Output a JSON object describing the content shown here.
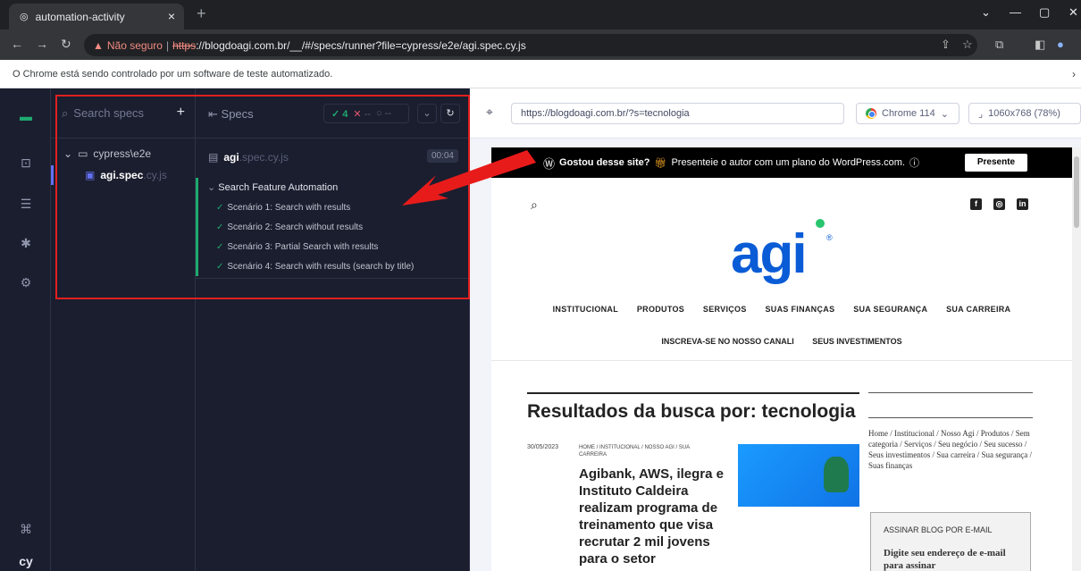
{
  "browser": {
    "tab_title": "automation-activity",
    "tab_close": "×",
    "new_tab": "+",
    "not_secure": "Não seguro",
    "url_scheme": "https",
    "url_rest": "://blogdoagi.com.br/__/#/specs/runner?file=cypress/e2e/agi.spec.cy.js",
    "automation_notice": "O Chrome está sendo controlado por um software de teste automatizado."
  },
  "specs_panel": {
    "search_placeholder": "Search specs",
    "folder": "cypress\\e2e",
    "file_name": "agi.spec",
    "file_ext": ".cy.js"
  },
  "reporter": {
    "title": "Specs",
    "passed": "4",
    "failed": "--",
    "pending": "--",
    "spec_name": "agi",
    "spec_ext": ".spec.cy.js",
    "duration": "00:04",
    "suite_title": "Search Feature Automation",
    "tests": [
      "Scenário 1: Search with results",
      "Scenário 2: Search without results",
      "Scenário 3: Partial Search with results",
      "Scenário 4: Search with results (search by title)"
    ]
  },
  "aut": {
    "url": "https://blogdoagi.com.br/?s=tecnologia",
    "browser": "Chrome 114",
    "viewport": "1060x768 (78%)"
  },
  "site": {
    "wp_bold": "Gostou desse site?",
    "wp_text": "Presenteie o autor com um plano do WordPress.com.",
    "wp_button": "Presente",
    "logo": "agi",
    "logo_reg": "®",
    "menu_row1": [
      "INSTITUCIONAL",
      "PRODUTOS",
      "SERVIÇOS",
      "SUAS FINANÇAS",
      "SUA SEGURANÇA",
      "SUA CARREIRA"
    ],
    "menu_row2": [
      "INSCREVA-SE NO NOSSO CANALI",
      "SEUS INVESTIMENTOS"
    ],
    "results_title": "Resultados da busca por: tecnologia",
    "post_date": "30/05/2023",
    "post_categories": "HOME / INSTITUCIONAL / NOSSO AGI / SUA CARREIRA",
    "post_title": "Agibank, AWS, ilegra e Instituto Caldeira realizam programa de treinamento que visa recrutar 2 mil jovens para o setor",
    "sidebar_categories": "Home / Institucional / Nosso Agi / Produtos / Sem categoria / Serviços / Seu negócio / Seu sucesso / Seus investimentos / Sua carreira / Sua segurança / Suas finanças",
    "subscribe_heading": "ASSINAR BLOG POR E-MAIL",
    "subscribe_text": "Digite seu endereço de e-mail para assinar"
  }
}
